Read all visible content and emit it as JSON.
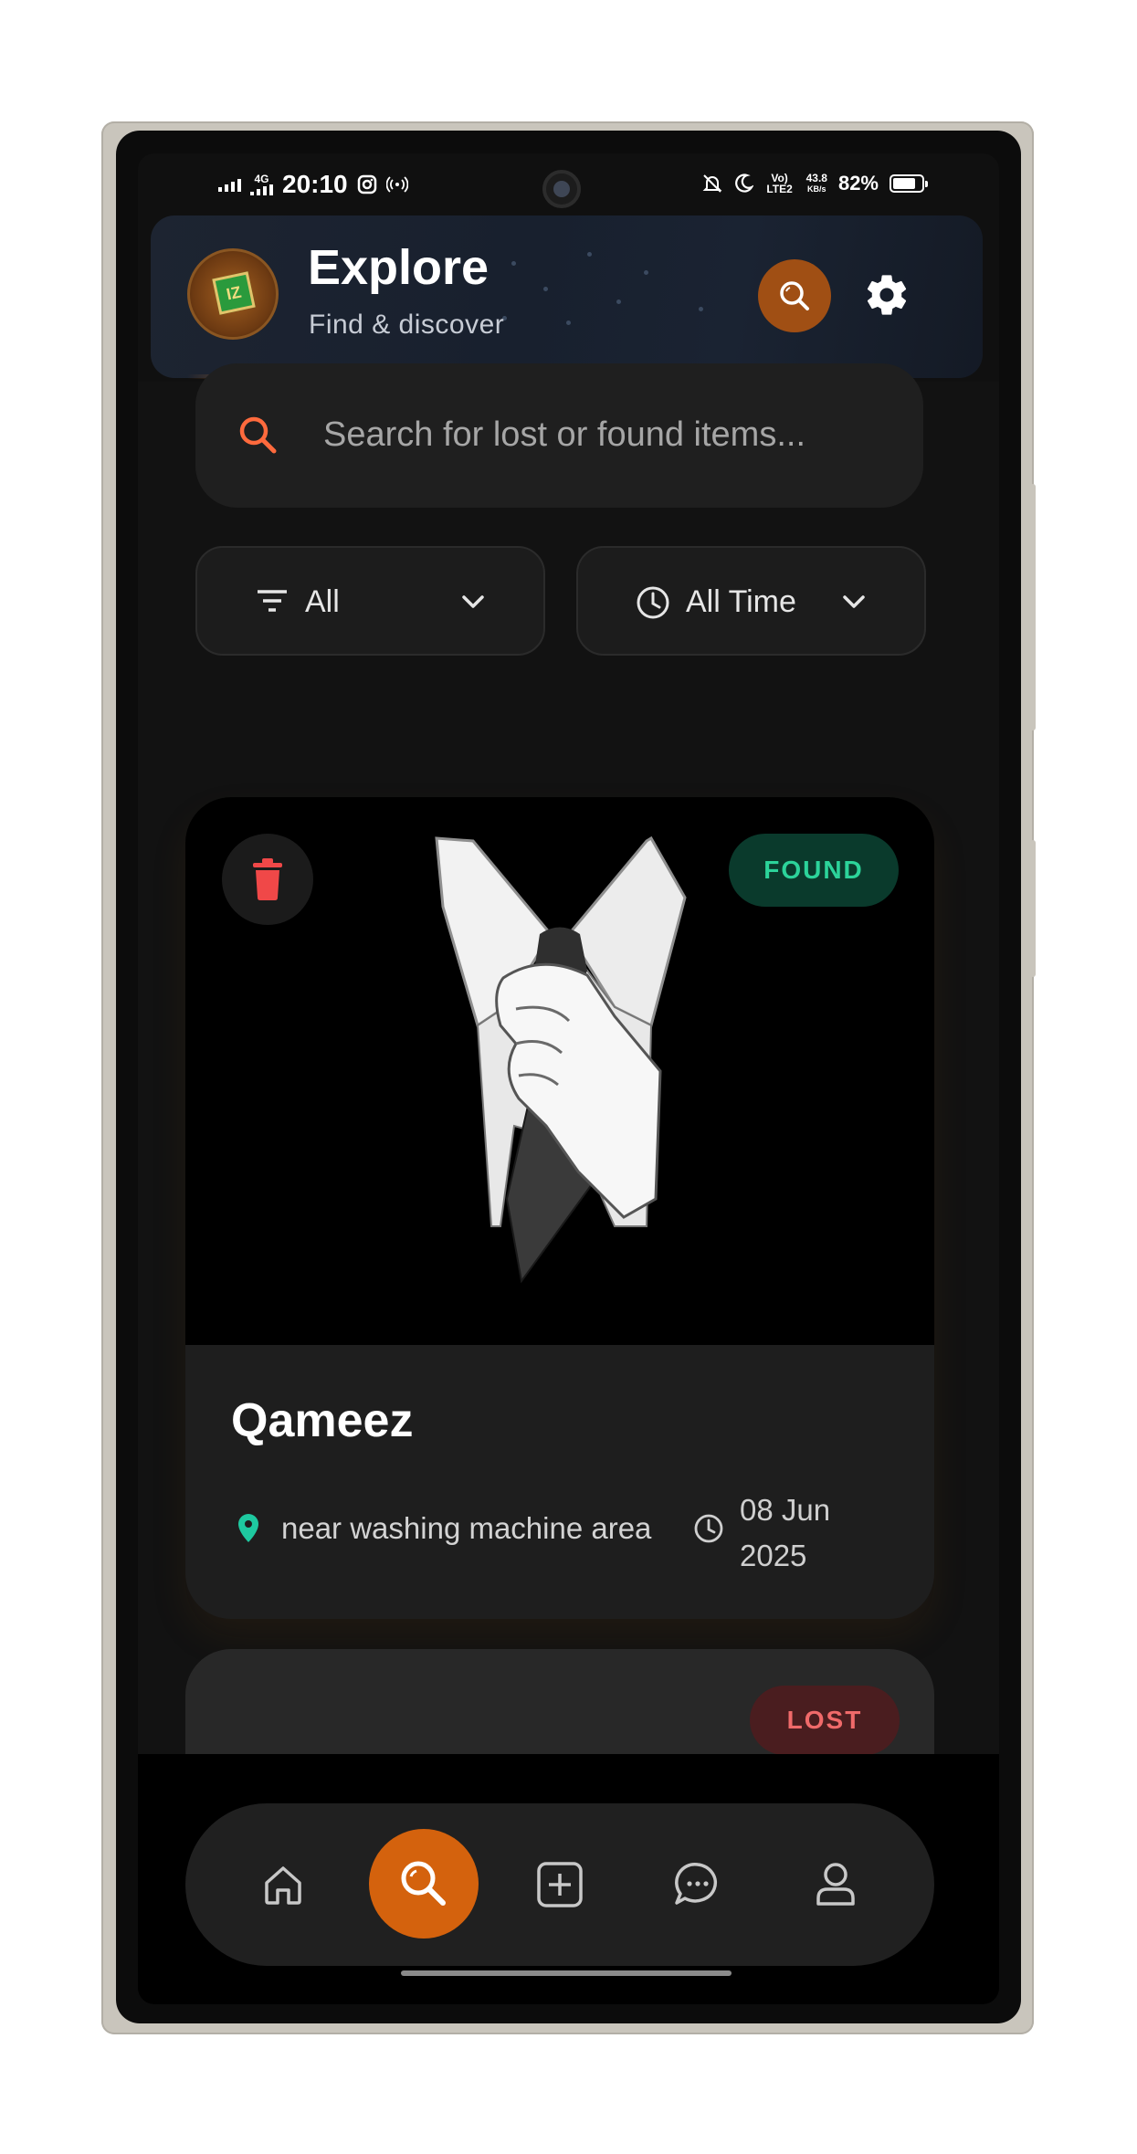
{
  "status_bar": {
    "network": "4G",
    "time": "20:10",
    "volte": "Vo) LTE2",
    "speed_value": "43.8",
    "speed_unit": "KB/s",
    "battery": "82%"
  },
  "header": {
    "title": "Explore",
    "subtitle": "Find & discover",
    "avatar_text": "IZ"
  },
  "search": {
    "placeholder": "Search for lost or found items..."
  },
  "filters": {
    "category": "All",
    "time": "All Time"
  },
  "items": [
    {
      "status": "FOUND",
      "title": "Qameez",
      "location": "near washing machine area",
      "date": "08 Jun 2025"
    },
    {
      "status": "LOST"
    }
  ],
  "colors": {
    "accent": "#d4620d",
    "found": "#2cd39a",
    "lost": "#f06a6a",
    "location_pin": "#1ec9a0",
    "delete": "#f04848"
  },
  "icons": {
    "nav": [
      "home-icon",
      "search-icon",
      "add-icon",
      "chat-icon",
      "profile-icon"
    ]
  }
}
